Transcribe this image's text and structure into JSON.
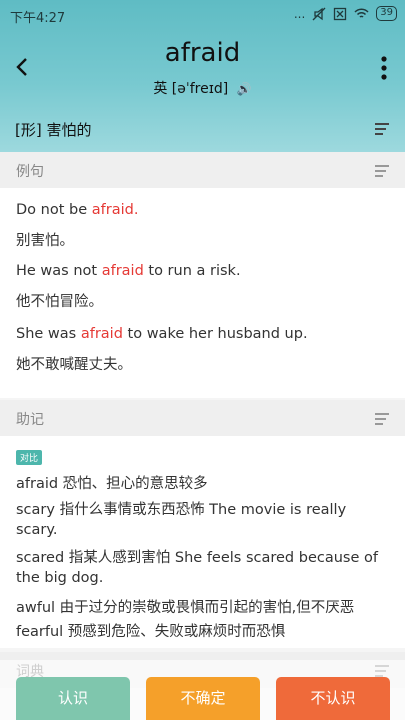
{
  "status_bar": {
    "time": "下午4:27",
    "dots": "...",
    "battery": "39"
  },
  "header": {
    "word": "afraid",
    "phonetic_label": "英",
    "phonetic": "[əˈfreɪd]",
    "meaning": "[形] 害怕的"
  },
  "examples": {
    "title": "例句",
    "items": [
      {
        "en_pre": "Do not be ",
        "en_key": "afraid.",
        "en_post": "",
        "zh": "别害怕。"
      },
      {
        "en_pre": "He was not ",
        "en_key": "afraid",
        "en_post": " to run a risk.",
        "zh": "他不怕冒险。"
      },
      {
        "en_pre": "She was ",
        "en_key": "afraid",
        "en_post": " to wake her husband up.",
        "zh": "她不敢喊醒丈夫。"
      }
    ]
  },
  "mnemonic": {
    "title": "助记",
    "tag": "对比",
    "lines": [
      "afraid   恐怕、担心的意思较多",
      "scary   指什么事情或东西恐怖   The movie is really",
      "scary.",
      "scared 指某人感到害怕   She feels scared  because of",
      "the big dog.",
      "awful   由于过分的崇敬或畏惧而引起的害怕,但不厌恶",
      "fearful   预感到危险、失败或麻烦时而恐惧"
    ]
  },
  "next_section": {
    "title": "词典"
  },
  "buttons": {
    "know": "认识",
    "unsure": "不确定",
    "unknown": "不认识"
  },
  "colors": {
    "know": "#7fc6ad",
    "unsure": "#f5a02a",
    "unknown": "#ef6a3a",
    "highlight": "#e53935"
  }
}
